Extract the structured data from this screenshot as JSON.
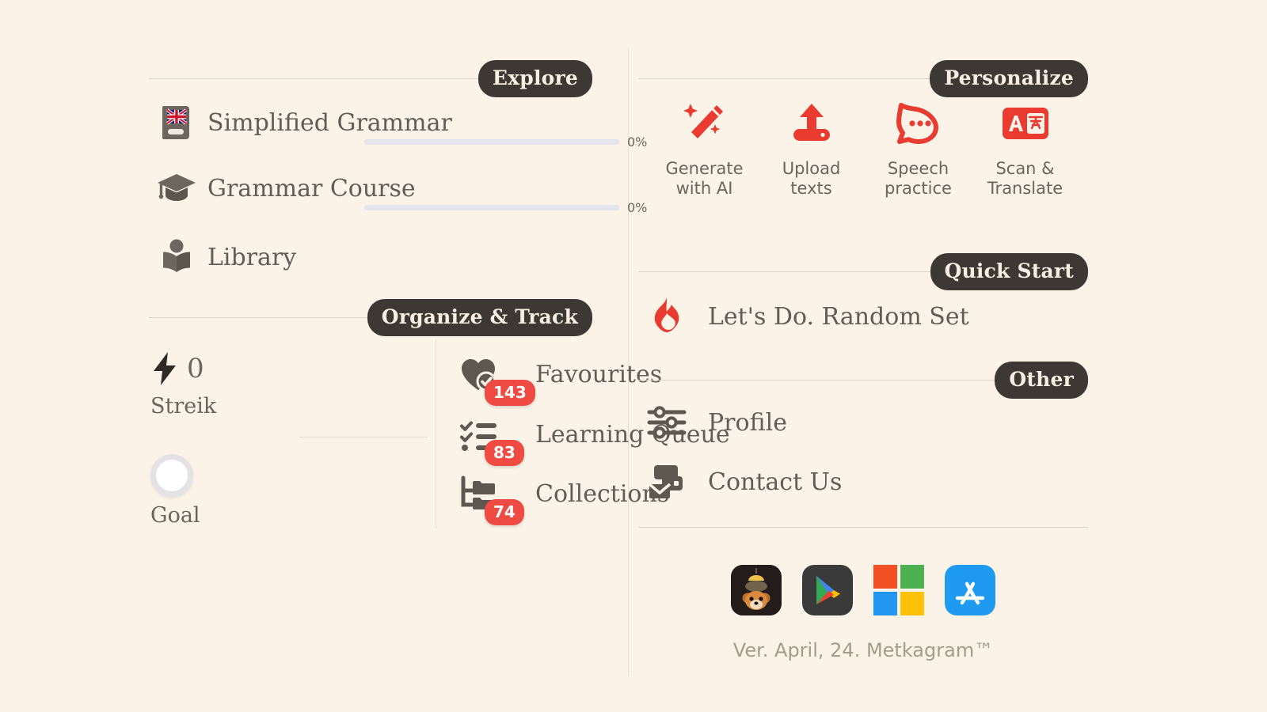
{
  "theme": {
    "background": "#fbf3e8",
    "accent_red": "#ea3b30",
    "badge_red": "#ef4b43",
    "pill_dark": "#3d3833",
    "text_gray": "#615c54",
    "icon_gray": "#6d665e",
    "rule": "#ddd4c6",
    "progress_track": "#e4e5ec"
  },
  "sections": {
    "explore": {
      "title": "Explore"
    },
    "organize": {
      "title": "Organize & Track"
    },
    "personalize": {
      "title": "Personalize"
    },
    "quick_start": {
      "title": "Quick Start"
    },
    "other": {
      "title": "Other"
    }
  },
  "explore": {
    "items": [
      {
        "label": "Simplified Grammar",
        "icon": "book-uk-flag-icon",
        "progress": 0,
        "progress_text": "0%"
      },
      {
        "label": "Grammar Course",
        "icon": "graduation-cap-icon",
        "progress": 0,
        "progress_text": "0%"
      },
      {
        "label": "Library",
        "icon": "library-person-book-icon"
      }
    ]
  },
  "organize": {
    "stats": [
      {
        "caption": "Streik",
        "icon": "lightning-bolt-icon",
        "value": "0"
      },
      {
        "caption": "Goal",
        "icon": "goal-ring-icon"
      }
    ],
    "items": [
      {
        "label": "Favourites",
        "icon": "heart-check-icon",
        "badge": "143"
      },
      {
        "label": "Learning Queue",
        "icon": "checklist-icon",
        "badge": "83"
      },
      {
        "label": "Collections",
        "icon": "folder-tree-icon",
        "badge": "74"
      }
    ]
  },
  "personalize": {
    "items": [
      {
        "label_line1": "Generate",
        "label_line2": "with AI",
        "icon": "magic-wand-sparkles-icon"
      },
      {
        "label_line1": "Upload",
        "label_line2": "texts",
        "icon": "upload-arrow-icon"
      },
      {
        "label_line1": "Speech",
        "label_line2": "practice",
        "icon": "speech-bubble-dots-icon"
      },
      {
        "label_line1": "Scan &",
        "label_line2": "Translate",
        "icon": "translate-a-glyph-icon"
      }
    ]
  },
  "quick_start": {
    "items": [
      {
        "label": "Let's Do. Random Set",
        "icon": "flame-icon"
      }
    ]
  },
  "other": {
    "items": [
      {
        "label": "Profile",
        "icon": "sliders-icon"
      },
      {
        "label": "Contact Us",
        "icon": "mail-cards-icon"
      }
    ]
  },
  "footer": {
    "stores": [
      {
        "name": "metkagram-bear-app-icon"
      },
      {
        "name": "google-play-icon"
      },
      {
        "name": "microsoft-store-icon"
      },
      {
        "name": "apple-app-store-icon"
      }
    ],
    "version": "Ver. April, 24. Metkagram™"
  }
}
